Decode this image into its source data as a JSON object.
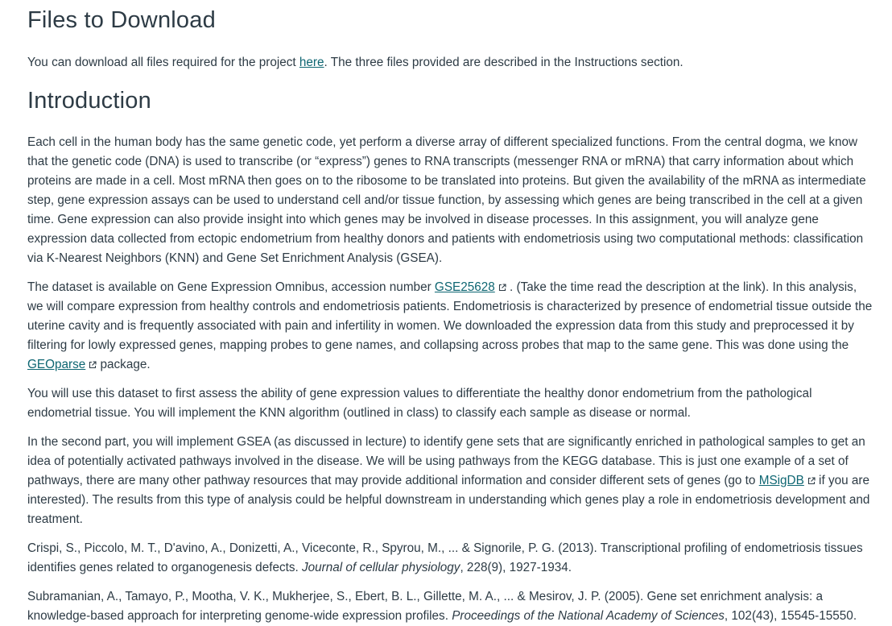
{
  "files": {
    "heading": "Files to Download",
    "text_before": "You can download all files required for the project ",
    "link": "here",
    "text_after": ". The three files provided are described in the Instructions section."
  },
  "intro": {
    "heading": "Introduction",
    "p1": "Each cell in the human body has the same genetic code, yet perform a diverse array of different specialized functions. From the central dogma, we know that the genetic code (DNA) is used to transcribe (or “express”) genes to RNA transcripts (messenger RNA or mRNA) that carry information about which proteins are made in a cell. Most mRNA then goes on to the ribosome to be translated into proteins. But given the availability of the mRNA as intermediate step, gene expression assays can be used to understand cell and/or tissue function, by assessing which genes are being transcribed in the cell at a given time. Gene expression can also provide insight into which genes may be involved in disease processes. In this assignment, you will analyze gene expression data collected from ectopic endometrium from healthy donors and patients with endometriosis using two computational methods: classification via K-Nearest Neighbors (KNN) and Gene Set Enrichment Analysis (GSEA).",
    "p2_a": "The dataset is available on Gene Expression Omnibus, accession number ",
    "p2_link1": "GSE25628",
    "p2_b": " . (Take the time read the description at the link). In this analysis, we will compare expression from healthy controls and endometriosis patients. Endometriosis is characterized by presence of endometrial tissue outside the uterine cavity and is frequently associated with pain and infertility in women. We downloaded the expression data from this study and preprocessed it by filtering for lowly expressed genes, mapping probes to gene names, and collapsing across probes that map to the same gene. This was done using the ",
    "p2_link2": "GEOparse",
    "p2_c": "  package.",
    "p3": "You will use this dataset to first assess the ability of gene expression values to differentiate the healthy donor endometrium from the pathological endometrial tissue. You will implement the KNN algorithm (outlined in class) to classify each sample as disease or normal.",
    "p4_a": "In the second part, you will implement GSEA (as discussed in lecture) to identify gene sets that are significantly enriched in pathological samples to get an idea of potentially activated pathways involved in the disease. We will be using pathways from the KEGG database. This is just one example of a set of pathways, there are many other pathway resources that may provide additional information and consider different sets of genes (go to ",
    "p4_link": "MSigDB",
    "p4_b": "  if you are interested). The results from this type of analysis could be helpful downstream in understanding which genes play a role in endometriosis development and treatment."
  },
  "refs": [
    {
      "authors": "Crispi, S., Piccolo, M. T., D'avino, A., Donizetti, A., Viceconte, R., Spyrou, M., ... & Signorile, P. G. (2013). Transcriptional profiling of endometriosis tissues identifies genes related to organogenesis defects. ",
      "journal": "Journal of cellular physiology",
      "tail": ", 228(9), 1927-1934."
    },
    {
      "authors": "Subramanian, A., Tamayo, P., Mootha, V. K., Mukherjee, S., Ebert, B. L., Gillette, M. A., ... & Mesirov, J. P. (2005). Gene set enrichment analysis: a knowledge-based approach for interpreting genome-wide expression profiles. ",
      "journal": "Proceedings of the National Academy of Sciences",
      "tail": ", 102(43), 15545-15550."
    }
  ]
}
